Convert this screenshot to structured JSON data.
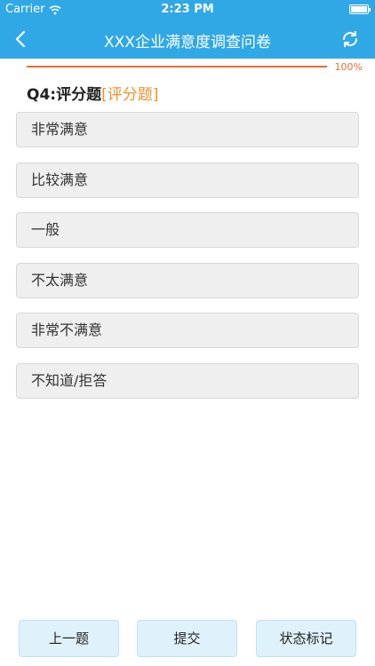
{
  "status_bar": {
    "carrier": "Carrier",
    "time": "2:23 PM"
  },
  "nav": {
    "title": "XXX企业满意度调查问卷"
  },
  "progress": {
    "percent_label": "100%",
    "value": 1.0,
    "color": "#ee6a34"
  },
  "question": {
    "number": "Q4:评分题",
    "type_tag": "[评分题]"
  },
  "options": [
    "非常满意",
    "比较满意",
    "一般",
    "不太满意",
    "非常不满意",
    "不知道/拒答"
  ],
  "footer": {
    "prev_label": "上一题",
    "submit_label": "提交",
    "status_label": "状态标记"
  },
  "colors": {
    "header": "#31a8e6",
    "accent": "#f0912b",
    "option_bg": "#efefef",
    "footer_btn_bg": "#dff1fb"
  },
  "icons": {
    "back": "chevron-left-icon",
    "refresh": "refresh-icon",
    "wifi": "wifi-icon",
    "battery": "battery-icon"
  }
}
